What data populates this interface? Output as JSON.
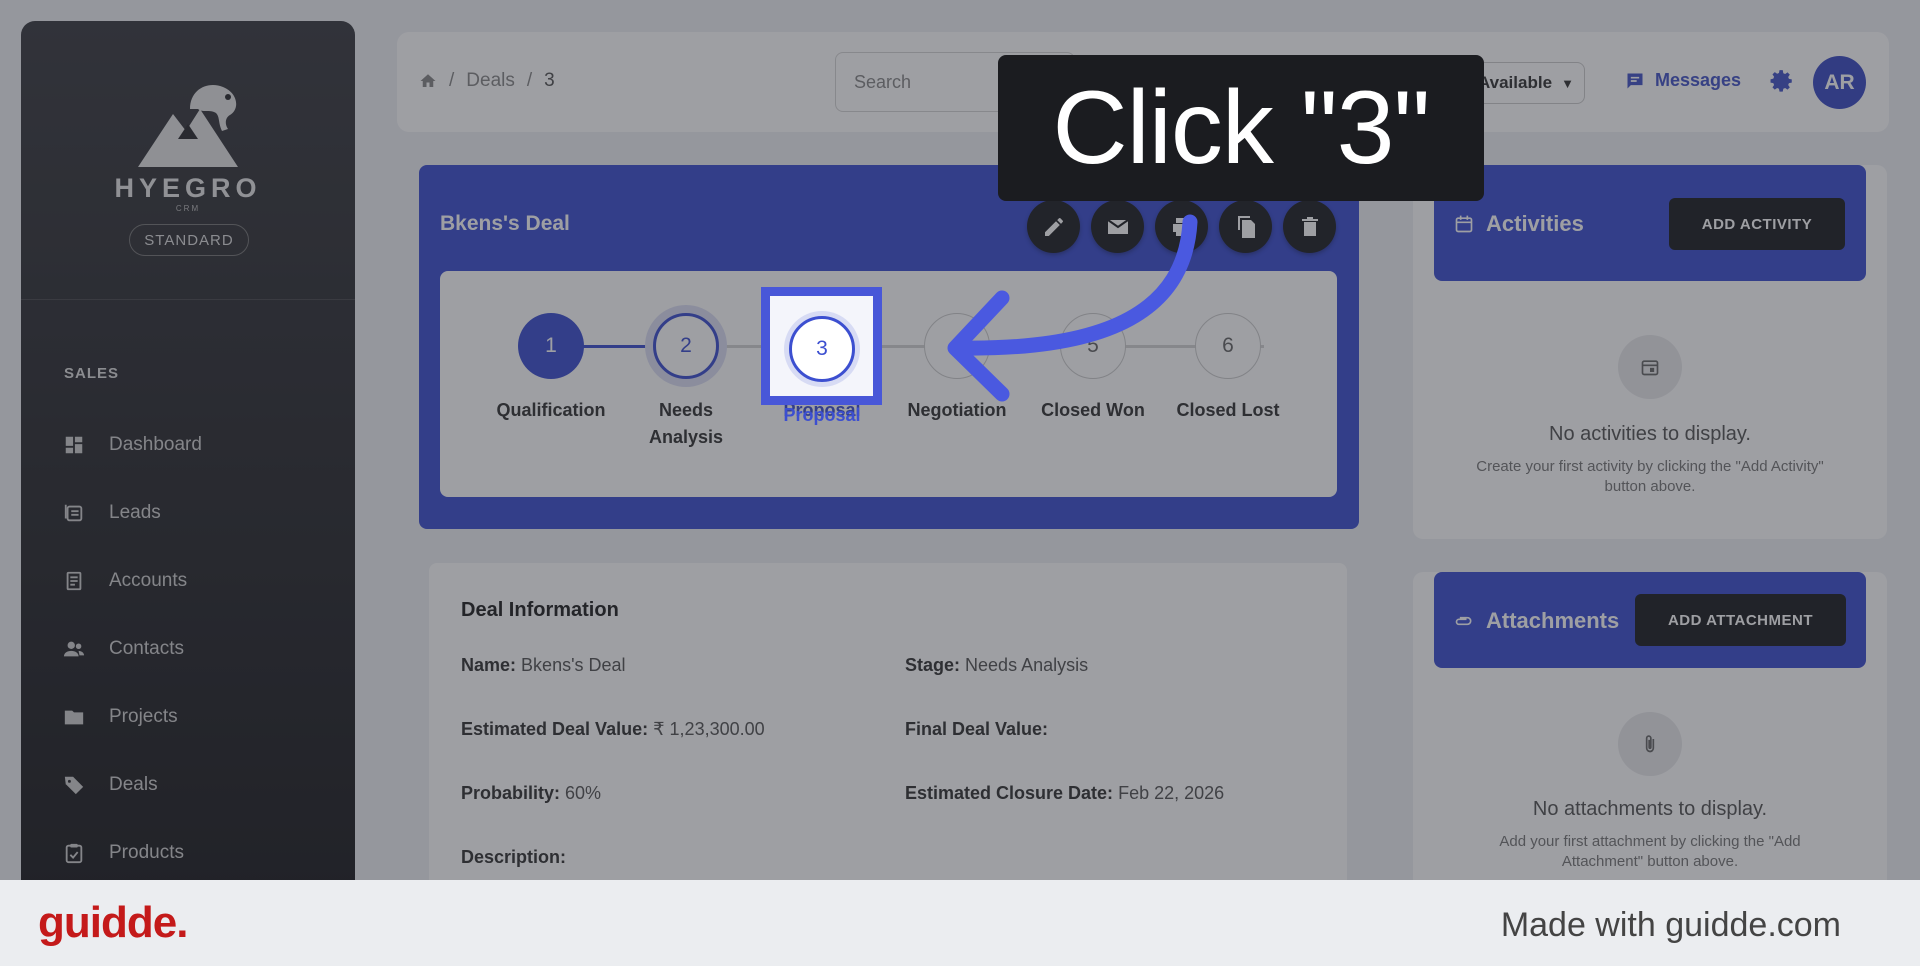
{
  "sidebar": {
    "logo_word": "HYEGRO",
    "logo_sub": "CRM",
    "plan": "STANDARD",
    "section": "SALES",
    "items": [
      {
        "label": "Dashboard",
        "icon": "dashboard-icon"
      },
      {
        "label": "Leads",
        "icon": "leads-icon"
      },
      {
        "label": "Accounts",
        "icon": "accounts-icon"
      },
      {
        "label": "Contacts",
        "icon": "contacts-icon"
      },
      {
        "label": "Projects",
        "icon": "folder-icon"
      },
      {
        "label": "Deals",
        "icon": "tag-icon"
      },
      {
        "label": "Products",
        "icon": "clipboard-icon"
      }
    ]
  },
  "topbar": {
    "breadcrumb": [
      "Deals",
      "3"
    ],
    "search_placeholder": "Search",
    "status": "Available",
    "messages": "Messages",
    "avatar": "AR"
  },
  "deal": {
    "title": "Bkens's Deal",
    "stages": [
      {
        "num": "1",
        "label": "Qualification"
      },
      {
        "num": "2",
        "label": "Needs Analysis"
      },
      {
        "num": "3",
        "label": "Proposal"
      },
      {
        "num": "4",
        "label": "Negotiation"
      },
      {
        "num": "5",
        "label": "Closed Won"
      },
      {
        "num": "6",
        "label": "Closed Lost"
      }
    ]
  },
  "info": {
    "heading": "Deal Information",
    "name_label": "Name:",
    "name": "Bkens's Deal",
    "stage_label": "Stage:",
    "stage": "Needs Analysis",
    "est_value_label": "Estimated Deal Value:",
    "est_value": "₹ 1,23,300.00",
    "final_value_label": "Final Deal Value:",
    "final_value": "",
    "prob_label": "Probability:",
    "prob": "60%",
    "closure_label": "Estimated Closure Date:",
    "closure": "Feb 22, 2026",
    "desc_label": "Description:"
  },
  "activities": {
    "title": "Activities",
    "button": "ADD ACTIVITY",
    "empty_title": "No activities to display.",
    "empty_sub": "Create your first activity by clicking the \"Add Activity\" button above."
  },
  "attachments": {
    "title": "Attachments",
    "button": "ADD ATTACHMENT",
    "empty_title": "No attachments to display.",
    "empty_sub": "Add your first attachment by clicking the \"Add Attachment\" button above."
  },
  "overlay": {
    "callout": "Click \"3\"",
    "highlight_num": "3",
    "highlight_label": "Proposal"
  },
  "footer": {
    "brand": "guidde.",
    "made_with": "Made with guidde.com"
  },
  "colors": {
    "primary": "#3c4fd0",
    "brand_red": "#c41a1a",
    "status_green": "#2e9d3c"
  }
}
